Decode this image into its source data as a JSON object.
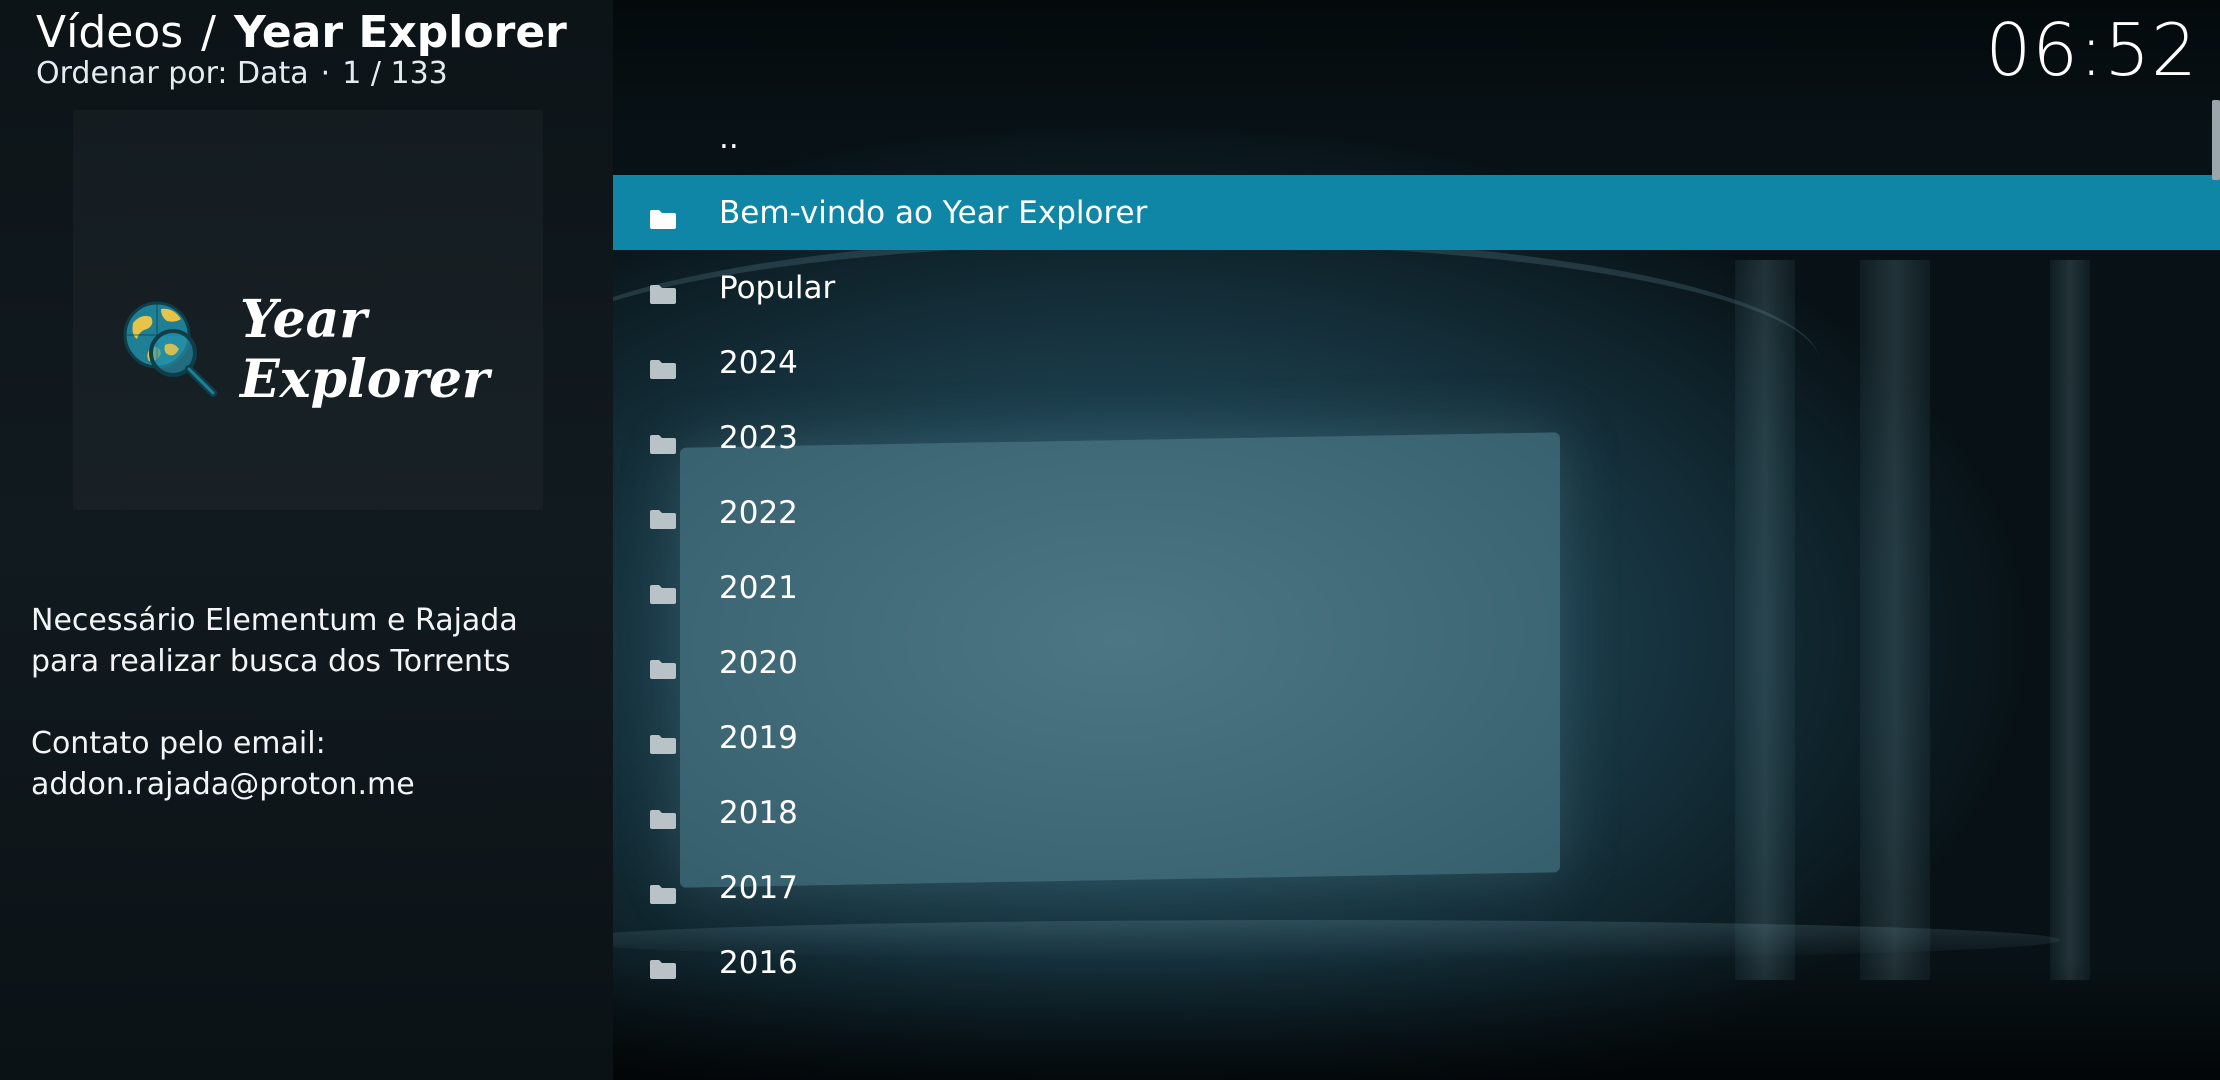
{
  "header": {
    "section": "Vídeos",
    "separator": "/",
    "current": "Year Explorer",
    "sort_label": "Ordenar por: Data",
    "sort_separator": "·",
    "position": "1 / 133"
  },
  "clock": "06:52",
  "addon": {
    "logo_line1": "Year",
    "logo_line2": "Explorer",
    "logo_icon": "globe-magnifier-icon",
    "plot_line1": "Necessário Elementum e Rajada",
    "plot_line2": "para realizar busca dos Torrents",
    "plot_line3": "Contato pelo email:",
    "plot_line4": "addon.rajada@proton.me"
  },
  "list": {
    "parent_label": "..",
    "items": [
      {
        "label": "Bem-vindo ao Year Explorer",
        "icon": "folder-icon",
        "selected": true
      },
      {
        "label": "Popular",
        "icon": "folder-icon",
        "selected": false
      },
      {
        "label": "2024",
        "icon": "folder-icon",
        "selected": false
      },
      {
        "label": "2023",
        "icon": "folder-icon",
        "selected": false
      },
      {
        "label": "2022",
        "icon": "folder-icon",
        "selected": false
      },
      {
        "label": "2021",
        "icon": "folder-icon",
        "selected": false
      },
      {
        "label": "2020",
        "icon": "folder-icon",
        "selected": false
      },
      {
        "label": "2019",
        "icon": "folder-icon",
        "selected": false
      },
      {
        "label": "2018",
        "icon": "folder-icon",
        "selected": false
      },
      {
        "label": "2017",
        "icon": "folder-icon",
        "selected": false
      },
      {
        "label": "2016",
        "icon": "folder-icon",
        "selected": false
      }
    ]
  },
  "colors": {
    "selection": "#0f86a6",
    "panel": "#111a1f",
    "text": "#ffffff"
  }
}
